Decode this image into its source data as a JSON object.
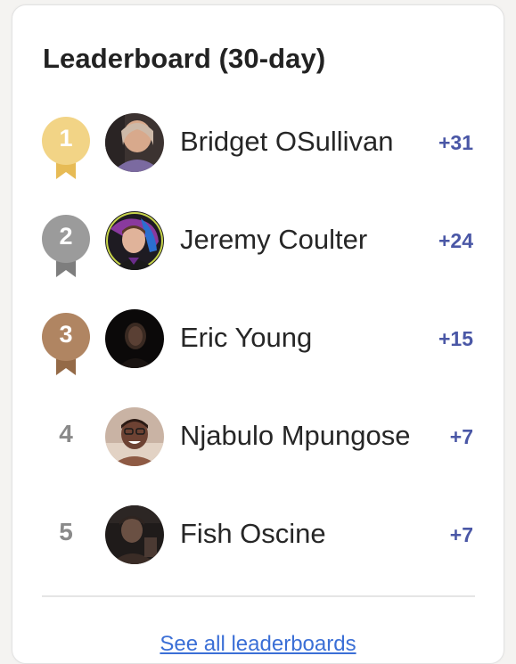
{
  "leaderboard": {
    "title": "Leaderboard (30-day)",
    "see_all_label": "See all leaderboards",
    "entries": [
      {
        "rank": "1",
        "name": "Bridget OSullivan",
        "score": "+31",
        "badge_color": "#f2d486",
        "ribbon_color": "#e7bb55"
      },
      {
        "rank": "2",
        "name": "Jeremy Coulter",
        "score": "+24",
        "badge_color": "#9b9b9b",
        "ribbon_color": "#7e7e7e"
      },
      {
        "rank": "3",
        "name": "Eric Young",
        "score": "+15",
        "badge_color": "#b08562",
        "ribbon_color": "#946a47"
      },
      {
        "rank": "4",
        "name": "Njabulo Mpungose",
        "score": "+7"
      },
      {
        "rank": "5",
        "name": "Fish Oscine",
        "score": "+7"
      }
    ]
  },
  "colors": {
    "score": "#4a57a6",
    "link": "#3b6fd6",
    "rank_plain": "#8a8a8a"
  }
}
